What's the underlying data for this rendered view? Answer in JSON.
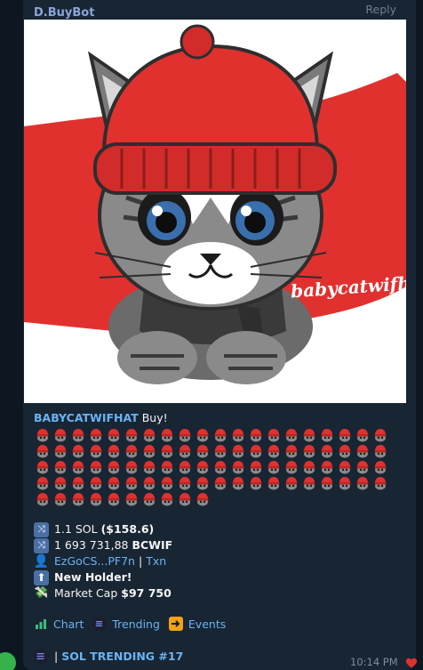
{
  "message": {
    "sender": "D.BuyBot",
    "reply_label": "Reply",
    "image_label": "babycatwifhat",
    "token": "BABYCATWIFHAT",
    "buy_word": "Buy!",
    "emoji_count": 90,
    "emoji_name": "cat-red-hat-icon",
    "stats": {
      "sol_amount": "1.1 SOL",
      "sol_usd": "($158.6)",
      "token_amount": "1 693 731,88",
      "token_symbol": "BCWIF",
      "wallet": "EzGoCS...PF7n",
      "separator": "|",
      "txn": "Txn",
      "new_holder": "New Holder!",
      "market_cap_label": "Market Cap",
      "market_cap_value": "$97 750"
    },
    "links": {
      "chart": "Chart",
      "trending": "Trending",
      "events": "Events"
    },
    "trending_separator": "|",
    "trending_text": "SOL TRENDING #17",
    "time": "10:14 PM"
  },
  "colors": {
    "accent_link": "#6ab3f3",
    "sender": "#8aa6d8",
    "bubble": "#182533",
    "background": "#0e1621",
    "hat_red": "#e0312f"
  }
}
